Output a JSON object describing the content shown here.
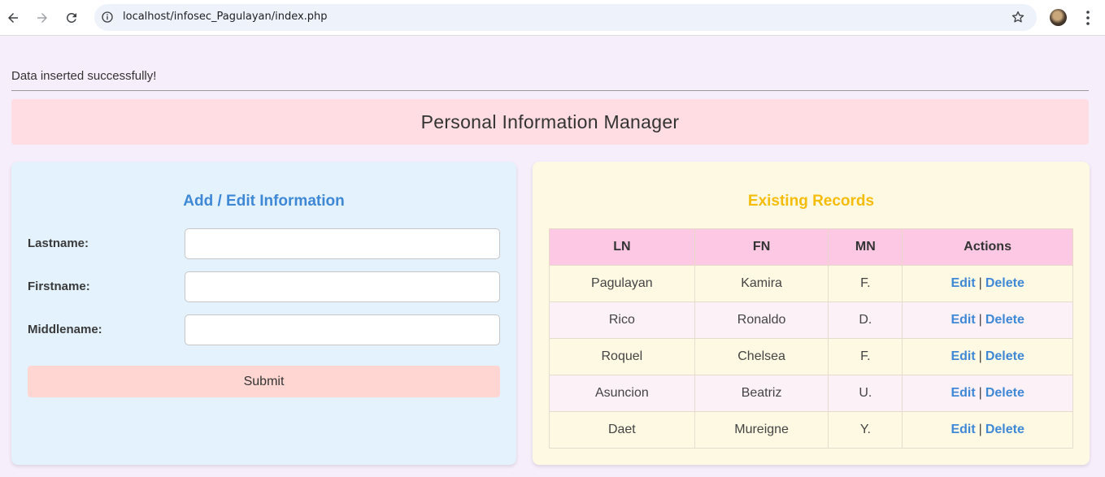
{
  "browser": {
    "url": "localhost/infosec_Pagulayan/index.php"
  },
  "status_message": "Data inserted successfully!",
  "header": {
    "title": "Personal Information Manager"
  },
  "form": {
    "heading": "Add / Edit Information",
    "lastname_label": "Lastname:",
    "firstname_label": "Firstname:",
    "middlename_label": "Middlename:",
    "lastname_value": "",
    "firstname_value": "",
    "middlename_value": "",
    "submit_label": "Submit"
  },
  "records": {
    "heading": "Existing Records",
    "columns": [
      "LN",
      "FN",
      "MN",
      "Actions"
    ],
    "edit_label": "Edit",
    "separator": "|",
    "delete_label": "Delete",
    "rows": [
      {
        "ln": "Pagulayan",
        "fn": "Kamira",
        "mn": "F."
      },
      {
        "ln": "Rico",
        "fn": "Ronaldo",
        "mn": "D."
      },
      {
        "ln": "Roquel",
        "fn": "Chelsea",
        "mn": "F."
      },
      {
        "ln": "Asuncion",
        "fn": "Beatriz",
        "mn": "U."
      },
      {
        "ln": "Daet",
        "fn": "Mureigne",
        "mn": "Y."
      }
    ]
  },
  "colors": {
    "page_bg": "#f7eefb",
    "header_bg": "#ffdde2",
    "form_panel_bg": "#e3f2fd",
    "records_panel_bg": "#fef9e3",
    "table_header_bg": "#fcc8e4",
    "accent_blue": "#3f88d6",
    "accent_yellow": "#f5bd0a",
    "submit_bg": "#ffd6d2"
  },
  "icons": [
    "back-arrow-icon",
    "forward-arrow-icon",
    "reload-icon",
    "info-icon",
    "star-icon",
    "avatar",
    "menu-dots-icon"
  ]
}
